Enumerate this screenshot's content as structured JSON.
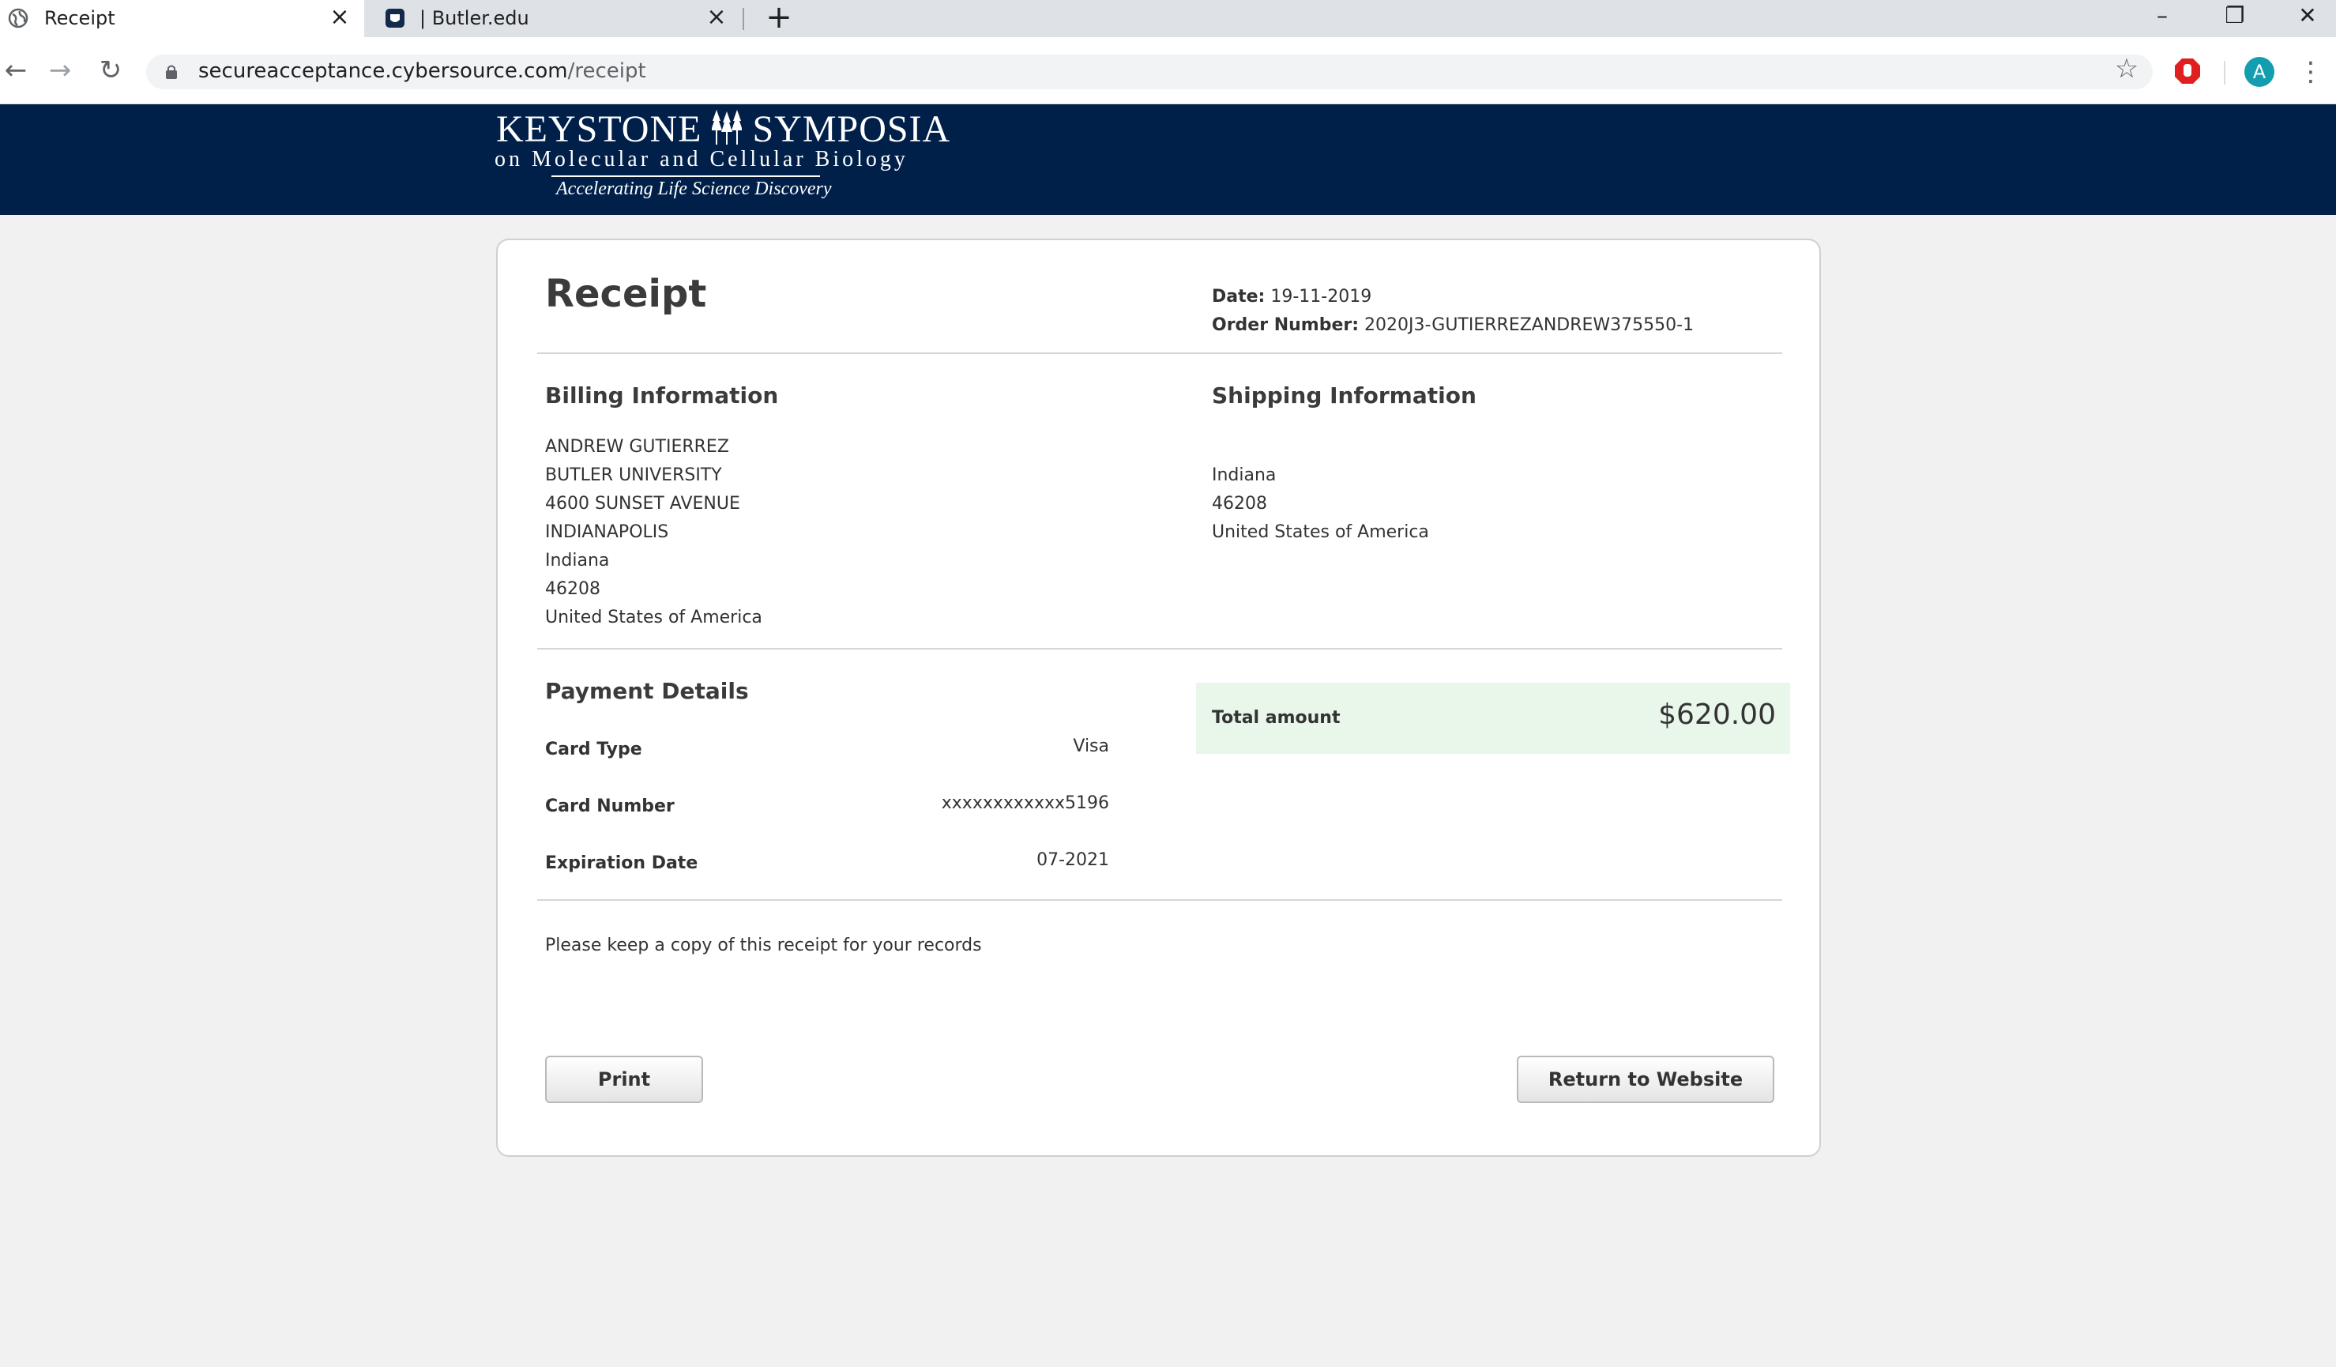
{
  "browser": {
    "tabs": [
      {
        "title": "Receipt",
        "active": true,
        "icon": "globe-icon"
      },
      {
        "title": "| Butler.edu",
        "active": false,
        "icon": "butler-bulldog-icon"
      }
    ],
    "url_host": "secureacceptance.cybersource.com",
    "url_path": "/receipt",
    "profile_initial": "A"
  },
  "header": {
    "logo_line1": "KEYSTONE",
    "logo_line1b": "SYMPOSIA",
    "logo_line2": "on Molecular and Cellular Biology",
    "logo_tagline": "Accelerating Life Science Discovery"
  },
  "receipt": {
    "title": "Receipt",
    "date_label": "Date:",
    "date_value": "19-11-2019",
    "order_label": "Order Number:",
    "order_value": "2020J3-GUTIERREZANDREW375550-1",
    "billing": {
      "heading": "Billing Information",
      "lines": [
        "ANDREW GUTIERREZ",
        "BUTLER UNIVERSITY",
        "4600 SUNSET AVENUE",
        "INDIANAPOLIS",
        "Indiana",
        "46208",
        "United States of America"
      ]
    },
    "shipping": {
      "heading": "Shipping Information",
      "lines": [
        "Indiana",
        "46208",
        "United States of America"
      ]
    },
    "payment": {
      "heading": "Payment Details",
      "card_type_label": "Card Type",
      "card_type_value": "Visa",
      "card_number_label": "Card Number",
      "card_number_value": "xxxxxxxxxxxx5196",
      "expiration_label": "Expiration Date",
      "expiration_value": "07-2021"
    },
    "total_label": "Total amount",
    "total_value": "$620.00",
    "note": "Please keep a copy of this receipt for your records",
    "print_label": "Print",
    "return_label": "Return to Website"
  },
  "colors": {
    "banner": "#00204a",
    "total_bg": "#e9f6ea",
    "profile": "#129eaf"
  }
}
